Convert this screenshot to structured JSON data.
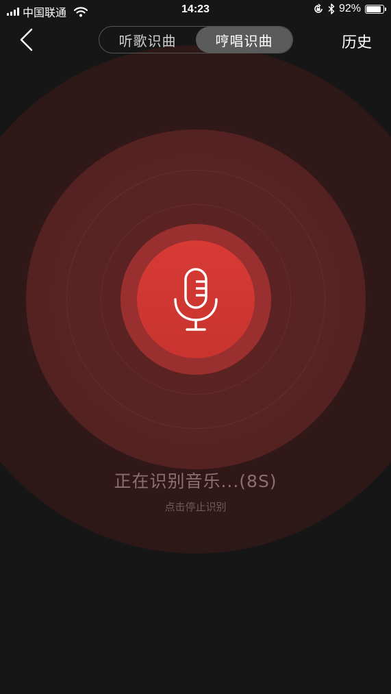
{
  "status_bar": {
    "carrier": "中国联通",
    "time": "14:23",
    "battery_text": "92%",
    "battery_level": 0.92,
    "icons": [
      "signal-icon",
      "wifi-icon",
      "orientation-lock-icon",
      "bluetooth-icon",
      "battery-icon"
    ]
  },
  "nav": {
    "back_icon": "chevron-left-icon",
    "tabs": [
      {
        "label": "听歌识曲",
        "active": false
      },
      {
        "label": "哼唱识曲",
        "active": true
      }
    ],
    "history_label": "历史"
  },
  "recognizer": {
    "icon": "microphone-icon",
    "status_title": "正在识别音乐...(8S)",
    "hint": "点击停止识别"
  },
  "colors": {
    "background": "#161616",
    "accent": "#d83a34",
    "segment_active": "#5b5b5b",
    "status_text": "#8c6f6f"
  }
}
